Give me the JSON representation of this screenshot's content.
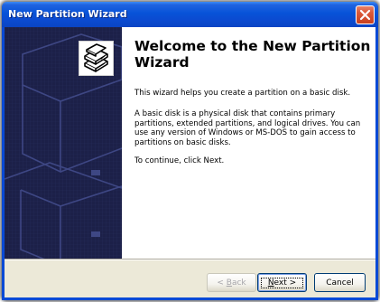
{
  "window": {
    "title": "New Partition Wizard",
    "close_icon": "close-x-icon",
    "accent": "#0a4ad6"
  },
  "side_panel": {
    "icon": "disk-stack-icon",
    "background": "#1c2048"
  },
  "content": {
    "heading": "Welcome to the New Partition Wizard",
    "paragraphs": [
      "This wizard helps you create a partition on a basic disk.",
      "A basic disk is a physical disk that contains primary partitions, extended partitions, and logical drives. You can use any version of Windows or MS-DOS to gain access to partitions on basic disks.",
      "To continue, click Next."
    ]
  },
  "buttons": {
    "back": {
      "prefix": "< ",
      "accel": "B",
      "rest": "ack",
      "enabled": false
    },
    "next": {
      "accel": "N",
      "rest": "ext >",
      "enabled": true
    },
    "cancel": {
      "label": "Cancel",
      "enabled": true
    }
  }
}
